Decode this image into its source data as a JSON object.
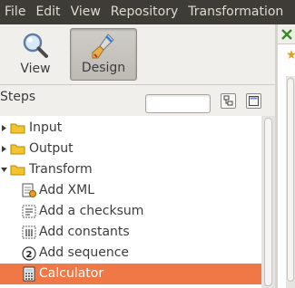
{
  "menubar": {
    "items": [
      "File",
      "Edit",
      "View",
      "Repository",
      "Transformation"
    ]
  },
  "perspectives": {
    "view_label": "View",
    "design_label": "Design",
    "active": "Design"
  },
  "steps_panel": {
    "title": "Steps",
    "filter_value": "",
    "tree": [
      {
        "label": "Input",
        "type": "folder",
        "expanded": false
      },
      {
        "label": "Output",
        "type": "folder",
        "expanded": false
      },
      {
        "label": "Transform",
        "type": "folder",
        "expanded": true
      },
      {
        "label": "Add XML",
        "type": "step",
        "icon": "add-xml-icon"
      },
      {
        "label": "Add a checksum",
        "type": "step",
        "icon": "checksum-icon"
      },
      {
        "label": "Add constants",
        "type": "step",
        "icon": "constants-icon"
      },
      {
        "label": "Add sequence",
        "type": "step",
        "icon": "sequence-icon"
      },
      {
        "label": "Calculator",
        "type": "step",
        "icon": "calculator-icon",
        "selected": true
      }
    ]
  },
  "colors": {
    "menubar_bg": "#3e3c37",
    "selection": "#f07746",
    "folder": "#f4c430"
  }
}
